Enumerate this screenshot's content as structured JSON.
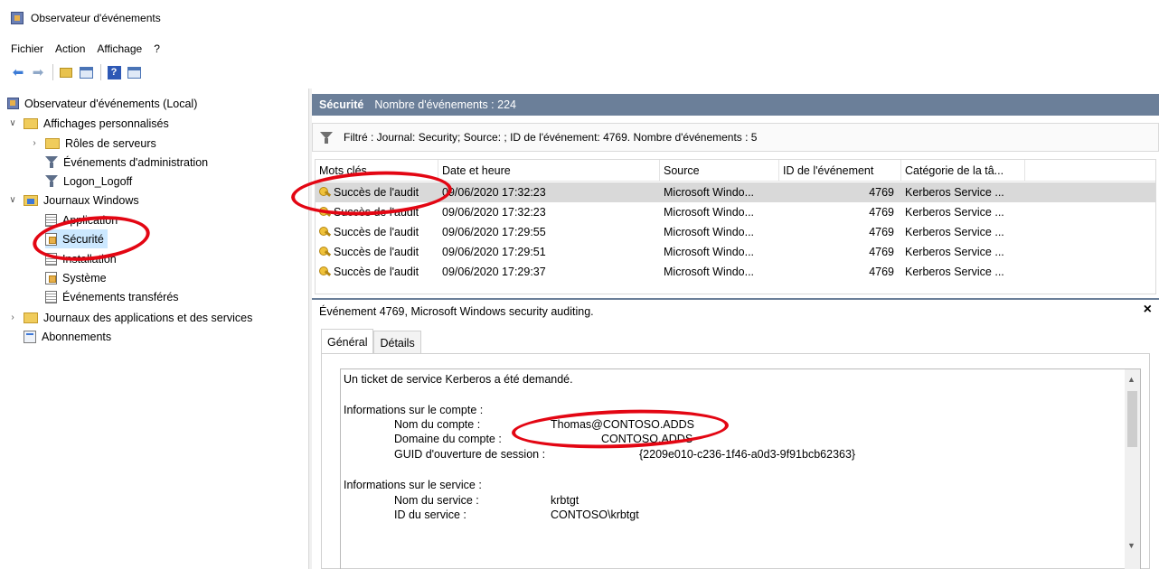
{
  "window": {
    "title": "Observateur d'événements"
  },
  "menu": [
    "Fichier",
    "Action",
    "Affichage",
    "?"
  ],
  "tree": {
    "root": "Observateur d'événements (Local)",
    "custom_views": "Affichages personnalisés",
    "server_roles": "Rôles de serveurs",
    "admin_events": "Événements d'administration",
    "logon_logoff": "Logon_Logoff",
    "windows_logs": "Journaux Windows",
    "application": "Application",
    "security": "Sécurité",
    "installation": "Installation",
    "system": "Système",
    "forwarded": "Événements transférés",
    "app_services_logs": "Journaux des applications et des services",
    "subscriptions": "Abonnements"
  },
  "log_header": {
    "name": "Sécurité",
    "count": "Nombre d'événements : 224"
  },
  "filter_text": "Filtré : Journal: Security; Source: ; ID de l'événement: 4769. Nombre d'événements : 5",
  "columns": [
    "Mots clés",
    "Date et heure",
    "Source",
    "ID de l'événement",
    "Catégorie de la tâ..."
  ],
  "events": [
    {
      "keyword": "Succès de l'audit",
      "datetime": "09/06/2020 17:32:23",
      "source": "Microsoft Windo...",
      "id": "4769",
      "category": "Kerberos Service ..."
    },
    {
      "keyword": "Succès de l'audit",
      "datetime": "09/06/2020 17:32:23",
      "source": "Microsoft Windo...",
      "id": "4769",
      "category": "Kerberos Service ..."
    },
    {
      "keyword": "Succès de l'audit",
      "datetime": "09/06/2020 17:29:55",
      "source": "Microsoft Windo...",
      "id": "4769",
      "category": "Kerberos Service ..."
    },
    {
      "keyword": "Succès de l'audit",
      "datetime": "09/06/2020 17:29:51",
      "source": "Microsoft Windo...",
      "id": "4769",
      "category": "Kerberos Service ..."
    },
    {
      "keyword": "Succès de l'audit",
      "datetime": "09/06/2020 17:29:37",
      "source": "Microsoft Windo...",
      "id": "4769",
      "category": "Kerberos Service ..."
    }
  ],
  "detail": {
    "title": "Événement 4769, Microsoft Windows security auditing.",
    "close": "×",
    "tabs": [
      "Général",
      "Détails"
    ],
    "intro": "Un ticket de service Kerberos a été demandé.",
    "account_section": "Informations sur le compte :",
    "account_name_label": "Nom du compte :",
    "account_name": "Thomas@CONTOSO.ADDS",
    "account_domain_label": "Domaine du compte :",
    "account_domain": "CONTOSO.ADDS",
    "logon_guid_label": "GUID d'ouverture de session :",
    "logon_guid": "{2209e010-c236-1f46-a0d3-9f91bcb62363}",
    "service_section": "Informations sur le service :",
    "service_name_label": "Nom du service :",
    "service_name": "krbtgt",
    "service_id_label": "ID du service :",
    "service_id": "CONTOSO\\krbtgt"
  },
  "annotation_color": "#e30613"
}
